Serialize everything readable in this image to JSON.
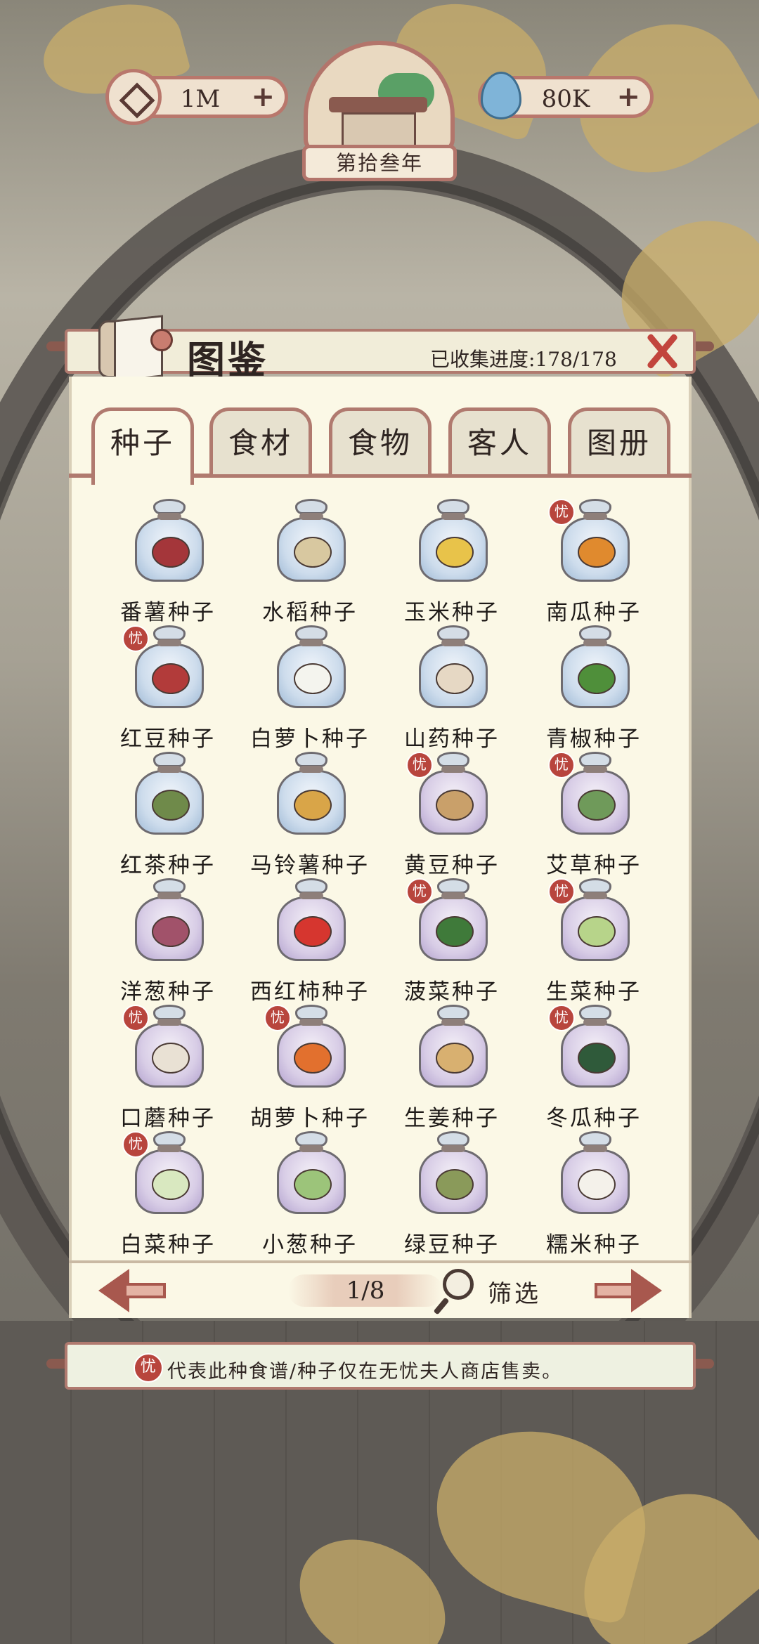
{
  "hud": {
    "coins": "1M",
    "jade": "80K",
    "year": "第拾叁年",
    "plus": "+"
  },
  "panel": {
    "title": "图鉴",
    "progress": "已收集进度:178/178"
  },
  "tabs": [
    {
      "label": "种子",
      "active": true
    },
    {
      "label": "食材",
      "active": false
    },
    {
      "label": "食物",
      "active": false
    },
    {
      "label": "客人",
      "active": false
    },
    {
      "label": "图册",
      "active": false
    }
  ],
  "badge_char": "忧",
  "items": [
    {
      "name": "番薯种子",
      "bag": "blue",
      "veg": "#a4363a",
      "badge": false
    },
    {
      "name": "水稻种子",
      "bag": "blue",
      "veg": "#d8c8a0",
      "badge": false
    },
    {
      "name": "玉米种子",
      "bag": "blue",
      "veg": "#e8c34a",
      "badge": false
    },
    {
      "name": "南瓜种子",
      "bag": "blue",
      "veg": "#e08a2e",
      "badge": true
    },
    {
      "name": "红豆种子",
      "bag": "blue",
      "veg": "#b23b3a",
      "badge": true
    },
    {
      "name": "白萝卜种子",
      "bag": "blue",
      "veg": "#f4f4ee",
      "badge": false
    },
    {
      "name": "山药种子",
      "bag": "blue",
      "veg": "#e6d8c4",
      "badge": false
    },
    {
      "name": "青椒种子",
      "bag": "blue",
      "veg": "#4f8f3a",
      "badge": false
    },
    {
      "name": "红茶种子",
      "bag": "blue",
      "veg": "#6f8a4a",
      "badge": false
    },
    {
      "name": "马铃薯种子",
      "bag": "blue",
      "veg": "#d9a548",
      "badge": false
    },
    {
      "name": "黄豆种子",
      "bag": "purple",
      "veg": "#c9a06a",
      "badge": true
    },
    {
      "name": "艾草种子",
      "bag": "purple",
      "veg": "#6f9a5a",
      "badge": true
    },
    {
      "name": "洋葱种子",
      "bag": "purple",
      "veg": "#a1526a",
      "badge": false
    },
    {
      "name": "西红柿种子",
      "bag": "purple",
      "veg": "#d6362f",
      "badge": false
    },
    {
      "name": "菠菜种子",
      "bag": "purple",
      "veg": "#3f7a3a",
      "badge": true
    },
    {
      "name": "生菜种子",
      "bag": "purple",
      "veg": "#b7d48a",
      "badge": true
    },
    {
      "name": "口蘑种子",
      "bag": "purple",
      "veg": "#e9e1d4",
      "badge": true
    },
    {
      "name": "胡萝卜种子",
      "bag": "purple",
      "veg": "#e2702e",
      "badge": true
    },
    {
      "name": "生姜种子",
      "bag": "purple",
      "veg": "#d8b070",
      "badge": false
    },
    {
      "name": "冬瓜种子",
      "bag": "purple",
      "veg": "#2f5a3a",
      "badge": true
    },
    {
      "name": "白菜种子",
      "bag": "purple",
      "veg": "#d9e8c0",
      "badge": true
    },
    {
      "name": "小葱种子",
      "bag": "purple",
      "veg": "#9cc47a",
      "badge": false
    },
    {
      "name": "绿豆种子",
      "bag": "purple",
      "veg": "#8a9a5a",
      "badge": false
    },
    {
      "name": "糯米种子",
      "bag": "purple",
      "veg": "#f4f1ea",
      "badge": false
    }
  ],
  "pager": {
    "page": "1/8",
    "filter": "筛选"
  },
  "note": "代表此种食谱/种子仅在无忧夫人商店售卖。",
  "colors": {
    "accent": "#b07a6f",
    "badge": "#b8453d",
    "panel": "#fbf8e6"
  }
}
